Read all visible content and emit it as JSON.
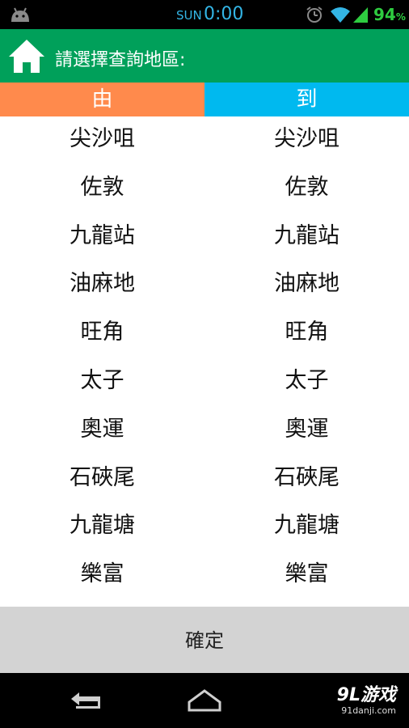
{
  "status_bar": {
    "day": "SUN",
    "time": "0:00",
    "battery": "94",
    "battery_unit": "%"
  },
  "header": {
    "title": "請選擇查詢地區:"
  },
  "columns": {
    "from_label": "由",
    "to_label": "到"
  },
  "from_list": [
    "尖沙咀",
    "佐敦",
    "九龍站",
    "油麻地",
    "旺角",
    "太子",
    "奧運",
    "石硤尾",
    "九龍塘",
    "樂富"
  ],
  "to_list": [
    "尖沙咀",
    "佐敦",
    "九龍站",
    "油麻地",
    "旺角",
    "太子",
    "奧運",
    "石硤尾",
    "九龍塘",
    "樂富"
  ],
  "confirm_label": "確定",
  "watermark": {
    "main": "9L游戏",
    "sub": "91danji.com"
  },
  "colors": {
    "header": "#00a05a",
    "from": "#ff8a4c",
    "to": "#00b9ef"
  }
}
